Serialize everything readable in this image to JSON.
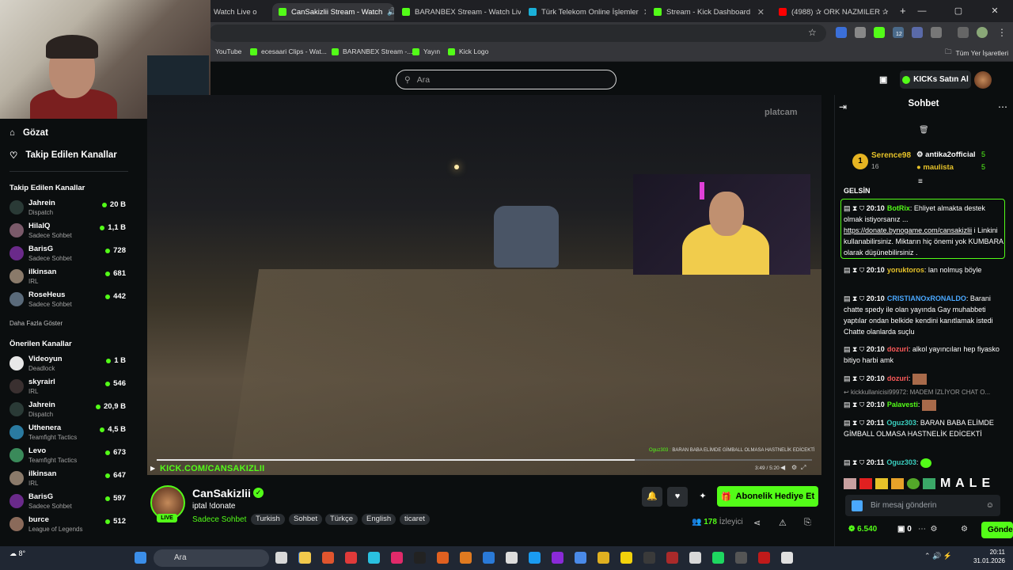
{
  "browser": {
    "tabs": [
      {
        "label": "Watch Live o",
        "active": false
      },
      {
        "label": "CanSakizlii Stream - Watch",
        "active": true
      },
      {
        "label": "BARANBEX Stream - Watch Live",
        "active": false
      },
      {
        "label": "Türk Telekom Online İşlemler",
        "active": false
      },
      {
        "label": "Stream - Kick Dashboard",
        "active": false
      },
      {
        "label": "(4988) ✰ ORK NAZMILER ✰",
        "active": false
      }
    ],
    "bookmarks": [
      "YouTube",
      "ecesaari Clips - Wat...",
      "BARANBEX Stream -...",
      "Yayın",
      "Kick Logo"
    ],
    "all_bookmarks": "Tüm Yer İşaretleri",
    "ext_badge": "12"
  },
  "header": {
    "search_placeholder": "Ara",
    "kicks_button": "KICKs Satın Al"
  },
  "sidebar": {
    "nav": [
      {
        "label": "Gözat",
        "icon": "home-icon"
      },
      {
        "label": "Takip Edilen Kanallar",
        "icon": "heart-icon"
      }
    ],
    "followed_heading": "Takip Edilen Kanallar",
    "followed": [
      {
        "name": "Jahrein",
        "category": "Dispatch",
        "viewers": "20 B",
        "color": "#2a3a36"
      },
      {
        "name": "HilalQ",
        "category": "Sadece Sohbet",
        "viewers": "1,1 B",
        "color": "#7a5a6a"
      },
      {
        "name": "BarisG",
        "category": "Sadece Sohbet",
        "viewers": "728",
        "color": "#6a2a8a"
      },
      {
        "name": "ilkinsan",
        "category": "IRL",
        "viewers": "681",
        "color": "#8a7a6a"
      },
      {
        "name": "RoseHeus",
        "category": "Sadece Sohbet",
        "viewers": "442",
        "color": "#5a6a7a"
      }
    ],
    "show_more": "Daha Fazla Göster",
    "recommended_heading": "Önerilen Kanallar",
    "recommended": [
      {
        "name": "Videoyun",
        "category": "Deadlock",
        "viewers": "1 B",
        "color": "#e8e8e8"
      },
      {
        "name": "skyrairl",
        "category": "IRL",
        "viewers": "546",
        "color": "#3a3030"
      },
      {
        "name": "Jahrein",
        "category": "Dispatch",
        "viewers": "20,9 B",
        "color": "#2a3a36"
      },
      {
        "name": "Uthenera",
        "category": "Teamfight Tactics",
        "viewers": "4,5 B",
        "color": "#2a7aa0"
      },
      {
        "name": "Levo",
        "category": "Teamfight Tactics",
        "viewers": "673",
        "color": "#3a8a5a"
      },
      {
        "name": "ilkinsan",
        "category": "IRL",
        "viewers": "647",
        "color": "#8a7a6a"
      },
      {
        "name": "BarisG",
        "category": "Sadece Sohbet",
        "viewers": "597",
        "color": "#6a2a8a"
      },
      {
        "name": "burce",
        "category": "League of Legends",
        "viewers": "512",
        "color": "#8a6a5a"
      }
    ]
  },
  "player": {
    "watermark": "platcam",
    "overlay_name": "Oguz303 :",
    "overlay_text": "BARAN BABA ELİMDE GİMBALL OLMASA HASTNELİK EDİCEKTİ",
    "url_text": "KICK.COM/CANSAKIZLII",
    "time": "3:49 / 5:20",
    "progress": 0.73
  },
  "stream": {
    "streamer": "CanSakizlii",
    "live": "LIVE",
    "title": "iptal !donate",
    "category": "Sadece Sohbet",
    "tags": [
      "Turkish",
      "Sohbet",
      "Türkçe",
      "English",
      "ticaret"
    ],
    "sub_button": "Abonelik Hediye Et",
    "viewer_count": "178",
    "viewer_label": "İzleyici"
  },
  "chat": {
    "title": "Sohbet",
    "leaderboard": [
      {
        "rank": "1",
        "name": "Serence98",
        "count": "16"
      },
      {
        "name": "antika2official",
        "count": "5"
      },
      {
        "name": "maulista",
        "count": "5"
      }
    ],
    "gelsin": "GELSİN",
    "messages": [
      {
        "time": "20:10",
        "user": "BotRix",
        "color": "#53fc18",
        "text": ": Ehliyet almakta destek olmak istiyorsanız ... ",
        "link": "https://donate.bynogame.com/cansakizlii",
        "text2": " i Linkini kullanabilirsiniz. Miktarın hiç önemi yok KUMBARA olarak düşünebilirsiniz ."
      },
      {
        "time": "20:10",
        "user": "yoruktoros",
        "color": "#e6c229",
        "text": ": lan nolmuş böyle"
      },
      {
        "time": "20:10",
        "user": "CRISTIANOxRONALDO",
        "color": "#4aa8ff",
        "text": ": Barani chatte spedy ile olan yayında Gay muhabbeti yaptılar ondan belkide kendini kanıtlamak istedi Chatte olanlarda suçlu"
      },
      {
        "time": "20:10",
        "user": "dozuri",
        "color": "#ff5a5a",
        "text": ": alkol yayıncıları hep fiyasko bitiyo harbi amk"
      },
      {
        "time": "20:10",
        "user": "dozuri",
        "color": "#ff5a5a",
        "text": ":"
      },
      {
        "reply": "kickkullanicisi99972: MADEM İZLİYOR CHAT O..."
      },
      {
        "time": "20:10",
        "user": "Palavesti",
        "color": "#53fc18",
        "text": ":"
      },
      {
        "time": "20:11",
        "user": "Oguz303",
        "color": "#3ad0c0",
        "text": ": BARAN BABA ELİMDE GİMBALL OLMASA HASTNELİK EDİCEKTİ"
      },
      {
        "time": "20:11",
        "user": "Oguz303",
        "color": "#3ad0c0",
        "text": ":"
      }
    ],
    "emote_text": "M A L E",
    "input_placeholder": "Bir mesaj gönderin",
    "points": "6.540",
    "zero": "0",
    "send": "Gönder"
  },
  "taskbar": {
    "search": "Ara",
    "time": "20:11",
    "date": "31.01.2026",
    "weather": "8°"
  }
}
